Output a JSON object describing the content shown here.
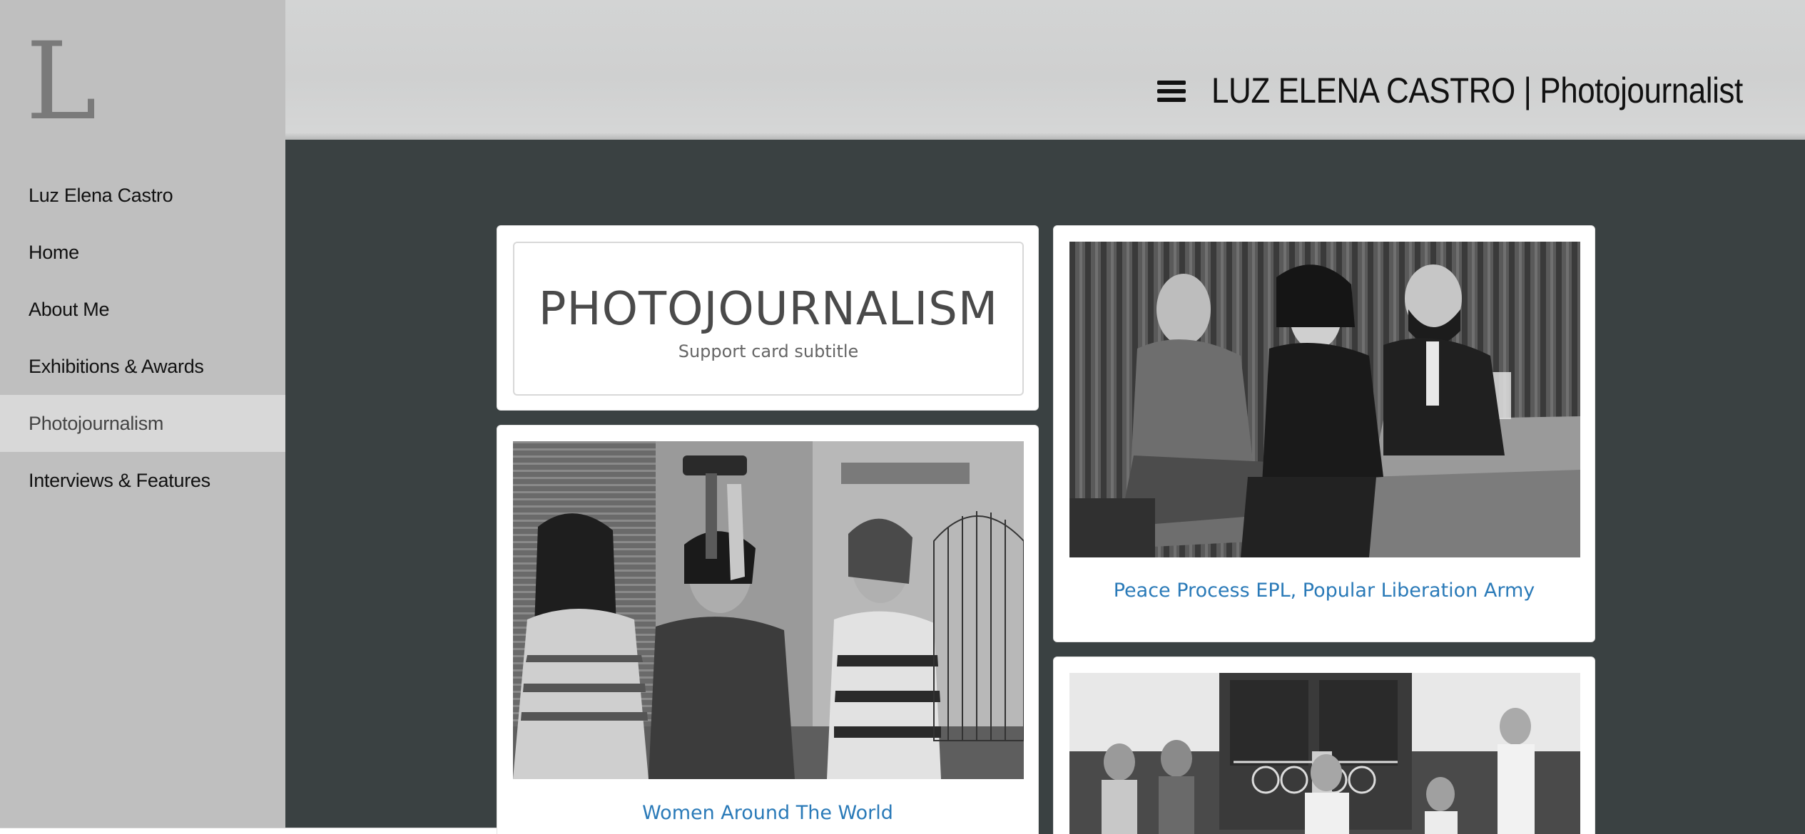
{
  "sidebar": {
    "logo_letter": "L",
    "items": [
      {
        "label": "Luz Elena Castro",
        "active": false
      },
      {
        "label": "Home",
        "active": false
      },
      {
        "label": "About Me",
        "active": false
      },
      {
        "label": "Exhibitions & Awards",
        "active": false
      },
      {
        "label": "Photojournalism",
        "active": true
      },
      {
        "label": "Interviews & Features",
        "active": false
      }
    ]
  },
  "header": {
    "menu_icon": "hamburger-menu-icon",
    "title": "LUZ ELENA CASTRO | Photojournalist"
  },
  "cards": {
    "intro": {
      "title": "PHOTOJOURNALISM",
      "subtitle": "Support card subtitle"
    },
    "peace": {
      "caption": "Peace Process EPL, Popular Liberation Army"
    },
    "women": {
      "caption": "Women Around The World"
    }
  },
  "colors": {
    "sidebar_bg": "#bfbfbf",
    "active_item_bg": "#d8d8d8",
    "content_bg": "#3a4142",
    "link": "#2a7ab8"
  }
}
